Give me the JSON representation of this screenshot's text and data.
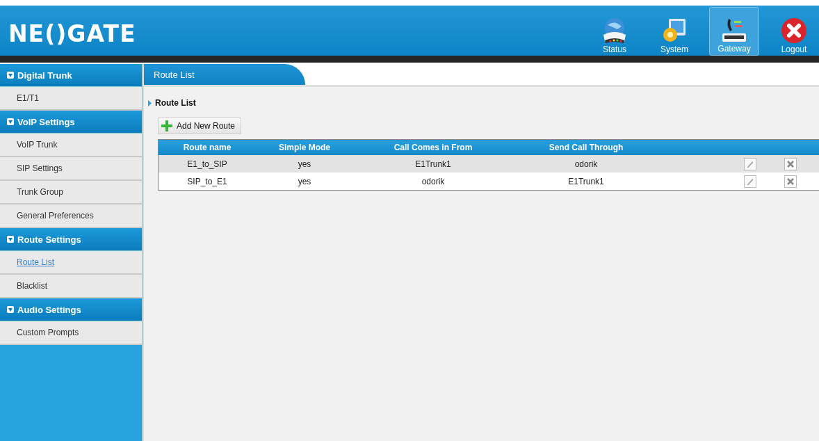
{
  "header": {
    "logo": "NE()GATE",
    "nav": [
      {
        "label": "Status",
        "kind": "status",
        "selected": false
      },
      {
        "label": "System",
        "kind": "system",
        "selected": false
      },
      {
        "label": "Gateway",
        "kind": "gateway",
        "selected": true
      },
      {
        "label": "Logout",
        "kind": "logout",
        "selected": false
      }
    ]
  },
  "sidebar": {
    "groups": [
      {
        "title": "Digital Trunk",
        "expanded": true,
        "items": [
          {
            "label": "E1/T1",
            "selected": false
          }
        ]
      },
      {
        "title": "VoIP Settings",
        "expanded": true,
        "items": [
          {
            "label": "VoIP Trunk",
            "selected": false
          },
          {
            "label": "SIP Settings",
            "selected": false
          },
          {
            "label": "Trunk Group",
            "selected": false
          },
          {
            "label": "General Preferences",
            "selected": false
          }
        ]
      },
      {
        "title": "Route Settings",
        "expanded": true,
        "items": [
          {
            "label": "Route List",
            "selected": true
          },
          {
            "label": "Blacklist",
            "selected": false
          }
        ]
      },
      {
        "title": "Audio Settings",
        "expanded": true,
        "items": [
          {
            "label": "Custom Prompts",
            "selected": false
          }
        ]
      }
    ]
  },
  "tab": {
    "label": "Route List"
  },
  "section_title": "Route List",
  "add_button": "Add New Route",
  "table": {
    "columns": [
      "Route name",
      "Simple Mode",
      "Call Comes in From",
      "Send Call Through"
    ],
    "rows": [
      {
        "cells": [
          "E1_to_SIP",
          "yes",
          "E1Trunk1",
          "odorik"
        ],
        "shaded": true
      },
      {
        "cells": [
          "SIP_to_E1",
          "yes",
          "odorik",
          "E1Trunk1"
        ],
        "shaded": false
      }
    ]
  }
}
